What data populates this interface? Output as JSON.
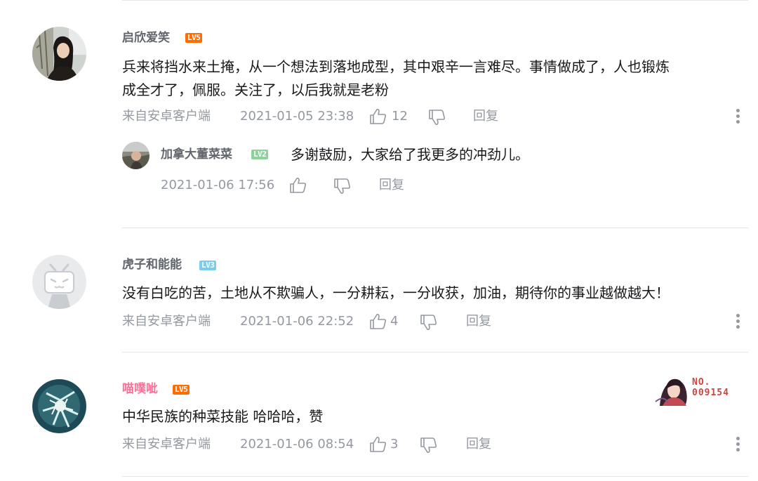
{
  "comments": [
    {
      "username": "启欣爱笑",
      "level": "LV5",
      "level_color": "#ff6c00",
      "content_line1": "兵来将挡水来土掩，从一个想法到落地成型，其中艰辛一言难尽。事情做成了，人也锻炼",
      "content_line2": "成全才了，佩服。关注了，以后我就是老粉",
      "source": "来自安卓客户端",
      "time": "2021-01-05 23:38",
      "likes": "12",
      "reply_label": "回复",
      "reply": {
        "username": "加拿大董菜菜",
        "level": "LV2",
        "level_color": "#8bd29b",
        "content": "多谢鼓励，大家给了我更多的冲劲儿。",
        "time": "2021-01-06 17:56",
        "reply_label": "回复"
      }
    },
    {
      "username": "虎子和能能",
      "level": "LV3",
      "level_color": "#7bcdef",
      "content": "没有白吃的苦，土地从不欺骗人，一分耕耘，一分收获，加油，期待你的事业越做越大！",
      "source": "来自安卓客户端",
      "time": "2021-01-06 22:52",
      "likes": "4",
      "reply_label": "回复"
    },
    {
      "username": "喵噗呲",
      "level": "LV5",
      "level_color": "#ff6c00",
      "content": "中华民族的种菜技能 哈哈哈，赞",
      "source": "来自安卓客户端",
      "time": "2021-01-06 08:54",
      "likes": "3",
      "reply_label": "回复",
      "pendant_line1": "NO.",
      "pendant_line2": "009154"
    }
  ]
}
